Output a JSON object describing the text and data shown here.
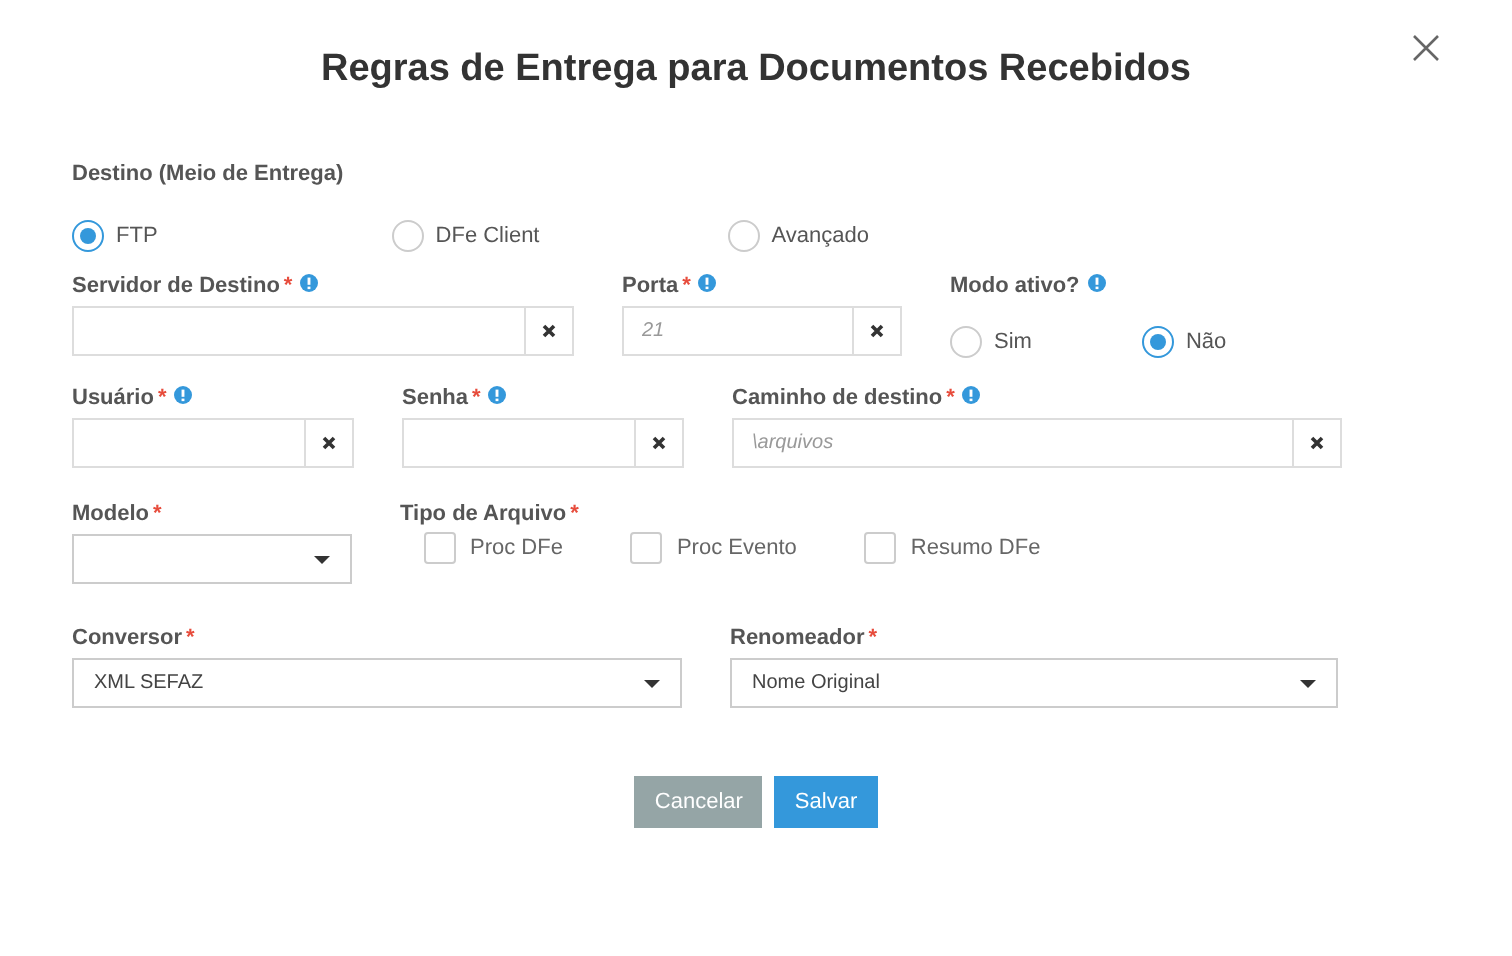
{
  "title": "Regras de Entrega para Documentos Recebidos",
  "destino": {
    "label": "Destino (Meio de Entrega)",
    "options": [
      {
        "label": "FTP",
        "selected": true
      },
      {
        "label": "DFe Client",
        "selected": false
      },
      {
        "label": "Avançado",
        "selected": false
      }
    ]
  },
  "rows": [
    {
      "fields": [
        {
          "kind": "text",
          "label": "Servidor de Destino",
          "mark": "*",
          "info": true
        },
        {
          "kind": "text",
          "label": "Porta",
          "mark": "*",
          "info": true,
          "placeholder": "21"
        },
        {
          "kind": "radio",
          "label": "Modo ativo?",
          "info": true,
          "options": [
            {
              "label": "Sim",
              "selected": false
            },
            {
              "label": "Não",
              "selected": true
            }
          ]
        }
      ]
    },
    {
      "fields": [
        {
          "kind": "text",
          "label": "Usuário",
          "mark": "*",
          "info": true
        },
        {
          "kind": "text",
          "label": "Senha",
          "mark": "*",
          "info": true
        },
        {
          "kind": "text",
          "label": "Caminho de destino",
          "mark": "*",
          "info": true,
          "placeholder": "\\arquivos"
        }
      ]
    },
    {
      "fields": [
        {
          "kind": "select",
          "label": "Modelo",
          "mark": "*"
        },
        {
          "kind": "checks",
          "label": "Tipo de Arquivo",
          "mark": "*",
          "options": [
            {
              "label": "Proc DFe",
              "checked": false
            },
            {
              "label": "Proc Evento",
              "checked": false
            },
            {
              "label": "Resumo DFe",
              "checked": false
            }
          ]
        }
      ]
    },
    {
      "fields": [
        {
          "kind": "select",
          "label": "Conversor",
          "mark": "*",
          "value": "XML SEFAZ"
        },
        {
          "kind": "select",
          "label": "Renomeador",
          "mark": "*",
          "value": "Nome Original"
        }
      ]
    }
  ],
  "buttons": [
    {
      "label": "Cancelar",
      "kind": "secondary"
    },
    {
      "label": "Salvar",
      "kind": "primary"
    }
  ]
}
